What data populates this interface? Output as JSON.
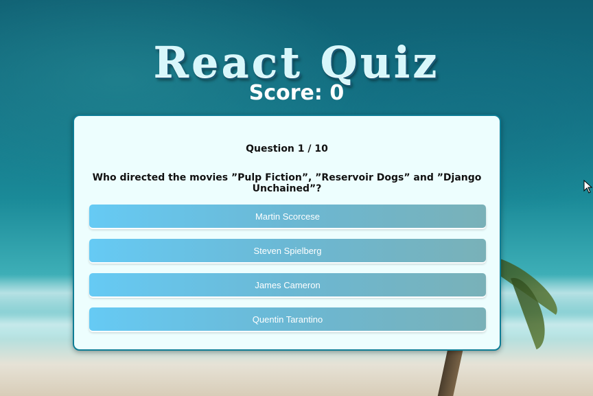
{
  "app": {
    "title": "React Quiz"
  },
  "score": {
    "label": "Score: 0"
  },
  "question": {
    "counter": "Question 1 / 10",
    "text": "Who directed the movies ”Pulp Fiction”, ”Reservoir Dogs” and ”Django Unchained”?"
  },
  "answers": [
    {
      "label": "Martin Scorcese"
    },
    {
      "label": "Steven Spielberg"
    },
    {
      "label": "James Cameron"
    },
    {
      "label": "Quentin Tarantino"
    }
  ],
  "colors": {
    "card_background": "#edfefe",
    "card_border": "#0e7d95",
    "answer_gradient_start": "#66caf4",
    "answer_gradient_end": "#79b1b8",
    "title_color": "#d8f7fb"
  },
  "icons": {
    "cursor": "mouse-pointer-icon"
  }
}
